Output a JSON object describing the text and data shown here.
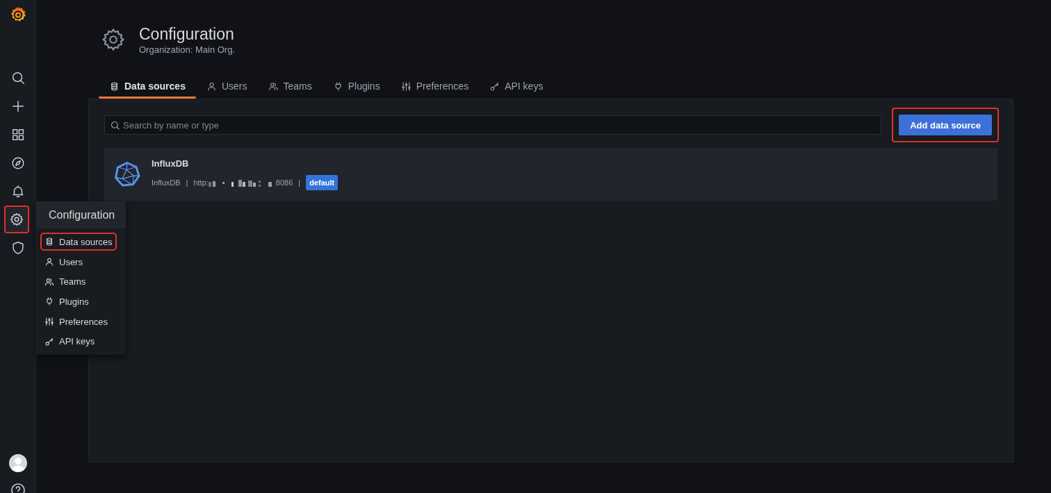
{
  "sidebar": {
    "items": [
      {
        "kind": "logo",
        "selected": false,
        "highlighted": false
      },
      {
        "kind": "search",
        "selected": false,
        "highlighted": false
      },
      {
        "kind": "plus",
        "selected": false,
        "highlighted": false
      },
      {
        "kind": "grid",
        "selected": false,
        "highlighted": false
      },
      {
        "kind": "compass",
        "selected": false,
        "highlighted": false
      },
      {
        "kind": "bell",
        "selected": false,
        "highlighted": false
      },
      {
        "kind": "gear",
        "selected": true,
        "highlighted": true
      },
      {
        "kind": "shield",
        "selected": false,
        "highlighted": false
      }
    ],
    "bottom_items": [
      {
        "kind": "avatar"
      },
      {
        "kind": "help"
      }
    ]
  },
  "flyout": {
    "title": "Configuration",
    "items": [
      {
        "kind": "database",
        "label": "Data sources",
        "highlighted": true
      },
      {
        "kind": "user",
        "label": "Users",
        "highlighted": false
      },
      {
        "kind": "users",
        "label": "Teams",
        "highlighted": false
      },
      {
        "kind": "plug",
        "label": "Plugins",
        "highlighted": false
      },
      {
        "kind": "sliders",
        "label": "Preferences",
        "highlighted": false
      },
      {
        "kind": "key",
        "label": "API keys",
        "highlighted": false
      }
    ]
  },
  "header": {
    "title": "Configuration",
    "subtitle": "Organization: Main Org."
  },
  "tabs": [
    {
      "kind": "database",
      "label": "Data sources",
      "selected": true
    },
    {
      "kind": "user",
      "label": "Users",
      "selected": false
    },
    {
      "kind": "users",
      "label": "Teams",
      "selected": false
    },
    {
      "kind": "plug",
      "label": "Plugins",
      "selected": false
    },
    {
      "kind": "sliders",
      "label": "Preferences",
      "selected": false
    },
    {
      "kind": "key",
      "label": "API keys",
      "selected": false
    }
  ],
  "search": {
    "placeholder": "Search by name or type"
  },
  "add_button": {
    "label": "Add data source",
    "highlighted": true
  },
  "datasources": [
    {
      "name": "InfluxDB",
      "type": "InfluxDB",
      "separators": [
        "|",
        "|"
      ],
      "url_start": "http:",
      "url_end": "8086",
      "redacted": true,
      "badge": "default"
    }
  ]
}
